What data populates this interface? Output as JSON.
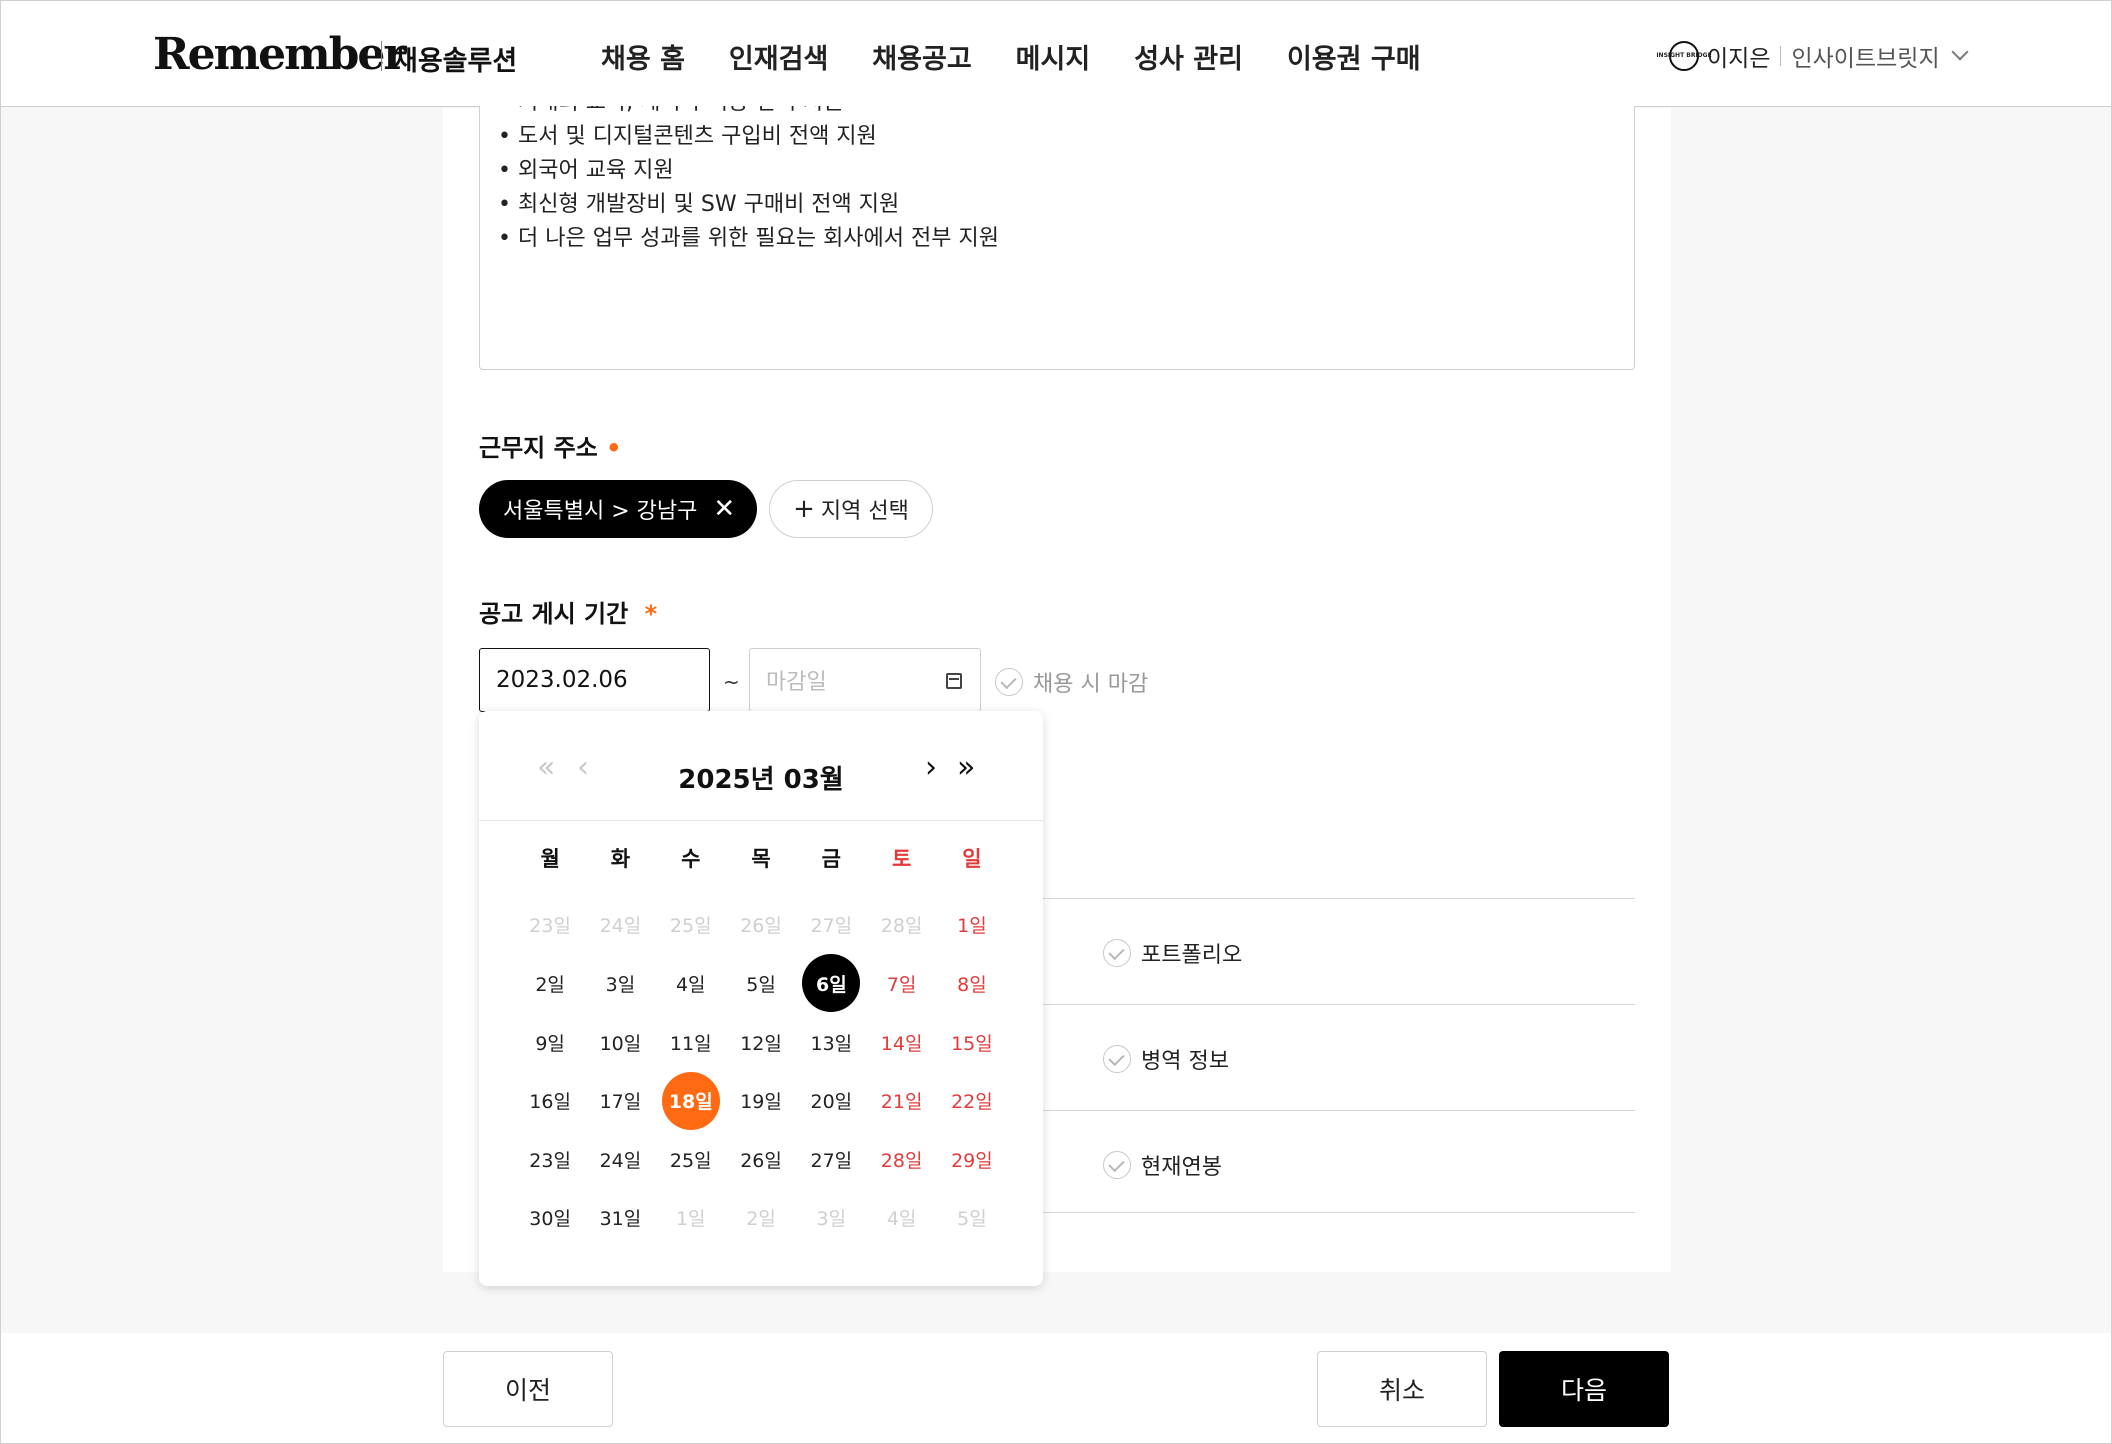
{
  "header": {
    "logo": "Remember",
    "logo_sub": "채용솔루션",
    "nav": [
      "채용 홈",
      "인재검색",
      "채용공고",
      "메시지",
      "성사 관리",
      "이용권 구매"
    ],
    "user_name": "이지은",
    "company": "인사이트브릿지",
    "company_logo_text": "INSIGHT BRIDGE"
  },
  "benefits": [
    "지대의 교육, 세미나 비용 전액 지원",
    "도서 및 디지털콘텐츠 구입비 전액 지원",
    "외국어 교육 지원",
    "최신형 개발장비 및 SW 구매비 전액 지원",
    "더 나은 업무 성과를 위한 필요는 회사에서 전부 지원"
  ],
  "location": {
    "label": "근무지 주소",
    "required_mark": "•",
    "selected": "서울특별시 > 강남구",
    "add_label": "지역 선택"
  },
  "period": {
    "label": "공고 게시 기간",
    "required_mark": "*",
    "start": "2023.02.06",
    "separator": "~",
    "end_placeholder": "마감일",
    "close_on_hire": "채용 시 마감"
  },
  "options": [
    "포트폴리오",
    "병역 정보",
    "현재연봉"
  ],
  "calendar": {
    "title": "2025년 03월",
    "weekdays": [
      "월",
      "화",
      "수",
      "목",
      "금",
      "토",
      "일"
    ],
    "weeks": [
      [
        "23일",
        "24일",
        "25일",
        "26일",
        "27일",
        "28일",
        "1일"
      ],
      [
        "2일",
        "3일",
        "4일",
        "5일",
        "6일",
        "7일",
        "8일"
      ],
      [
        "9일",
        "10일",
        "11일",
        "12일",
        "13일",
        "14일",
        "15일"
      ],
      [
        "16일",
        "17일",
        "18일",
        "19일",
        "20일",
        "21일",
        "22일"
      ],
      [
        "23일",
        "24일",
        "25일",
        "26일",
        "27일",
        "28일",
        "29일"
      ],
      [
        "30일",
        "31일",
        "1일",
        "2일",
        "3일",
        "4일",
        "5일"
      ]
    ]
  },
  "footer": {
    "prev": "이전",
    "cancel": "취소",
    "next": "다음"
  },
  "colors": {
    "accent": "#ff6a13",
    "weekend": "#e23b3b",
    "primary": "#000000"
  }
}
